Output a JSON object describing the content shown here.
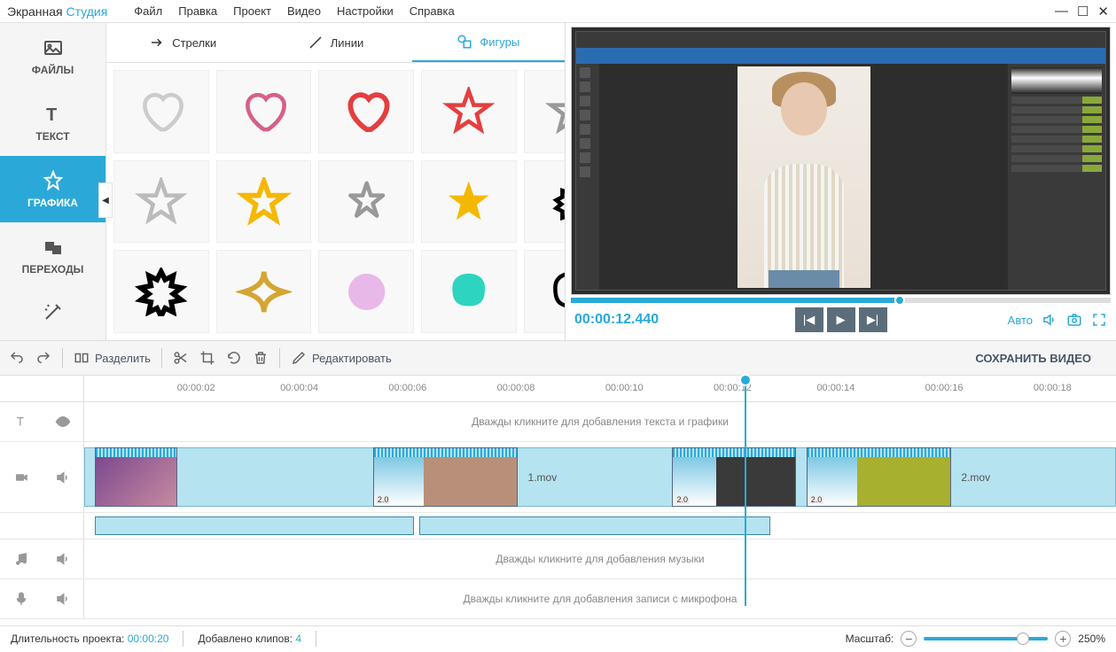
{
  "app": {
    "title1": "Экранная",
    "title2": "Студия"
  },
  "menu": {
    "file": "Файл",
    "edit": "Правка",
    "project": "Проект",
    "video": "Видео",
    "settings": "Настройки",
    "help": "Справка"
  },
  "sidebar": {
    "files": "ФАЙЛЫ",
    "text": "ТЕКСТ",
    "graphics": "ГРАФИКА",
    "transitions": "ПЕРЕХОДЫ"
  },
  "shapes_tabs": {
    "arrows": "Стрелки",
    "lines": "Линии",
    "figures": "Фигуры"
  },
  "preview": {
    "time": "00:00:12.440",
    "auto": "Авто"
  },
  "toolbar": {
    "split": "Разделить",
    "edit": "Редактировать",
    "save": "СОХРАНИТЬ ВИДЕО"
  },
  "ruler": {
    "ticks": [
      "00:00:02",
      "00:00:04",
      "00:00:06",
      "00:00:08",
      "00:00:10",
      "00:00:12",
      "00:00:14",
      "00:00:16",
      "00:00:18"
    ]
  },
  "tracks": {
    "text_hint": "Дважды кликните для добавления текста и графики",
    "audio_hint": "Дважды кликните для добавления музыки",
    "mic_hint": "Дважды кликните для добавления записи с микрофона",
    "clip1_label": "1.mov",
    "clip2_label": "2.mov",
    "fade_badge": "2.0"
  },
  "status": {
    "duration_label": "Длительность проекта:",
    "duration_value": "00:00:20",
    "clips_label": "Добавлено клипов:",
    "clips_value": "4",
    "zoom_label": "Масштаб:",
    "zoom_value": "250%"
  }
}
